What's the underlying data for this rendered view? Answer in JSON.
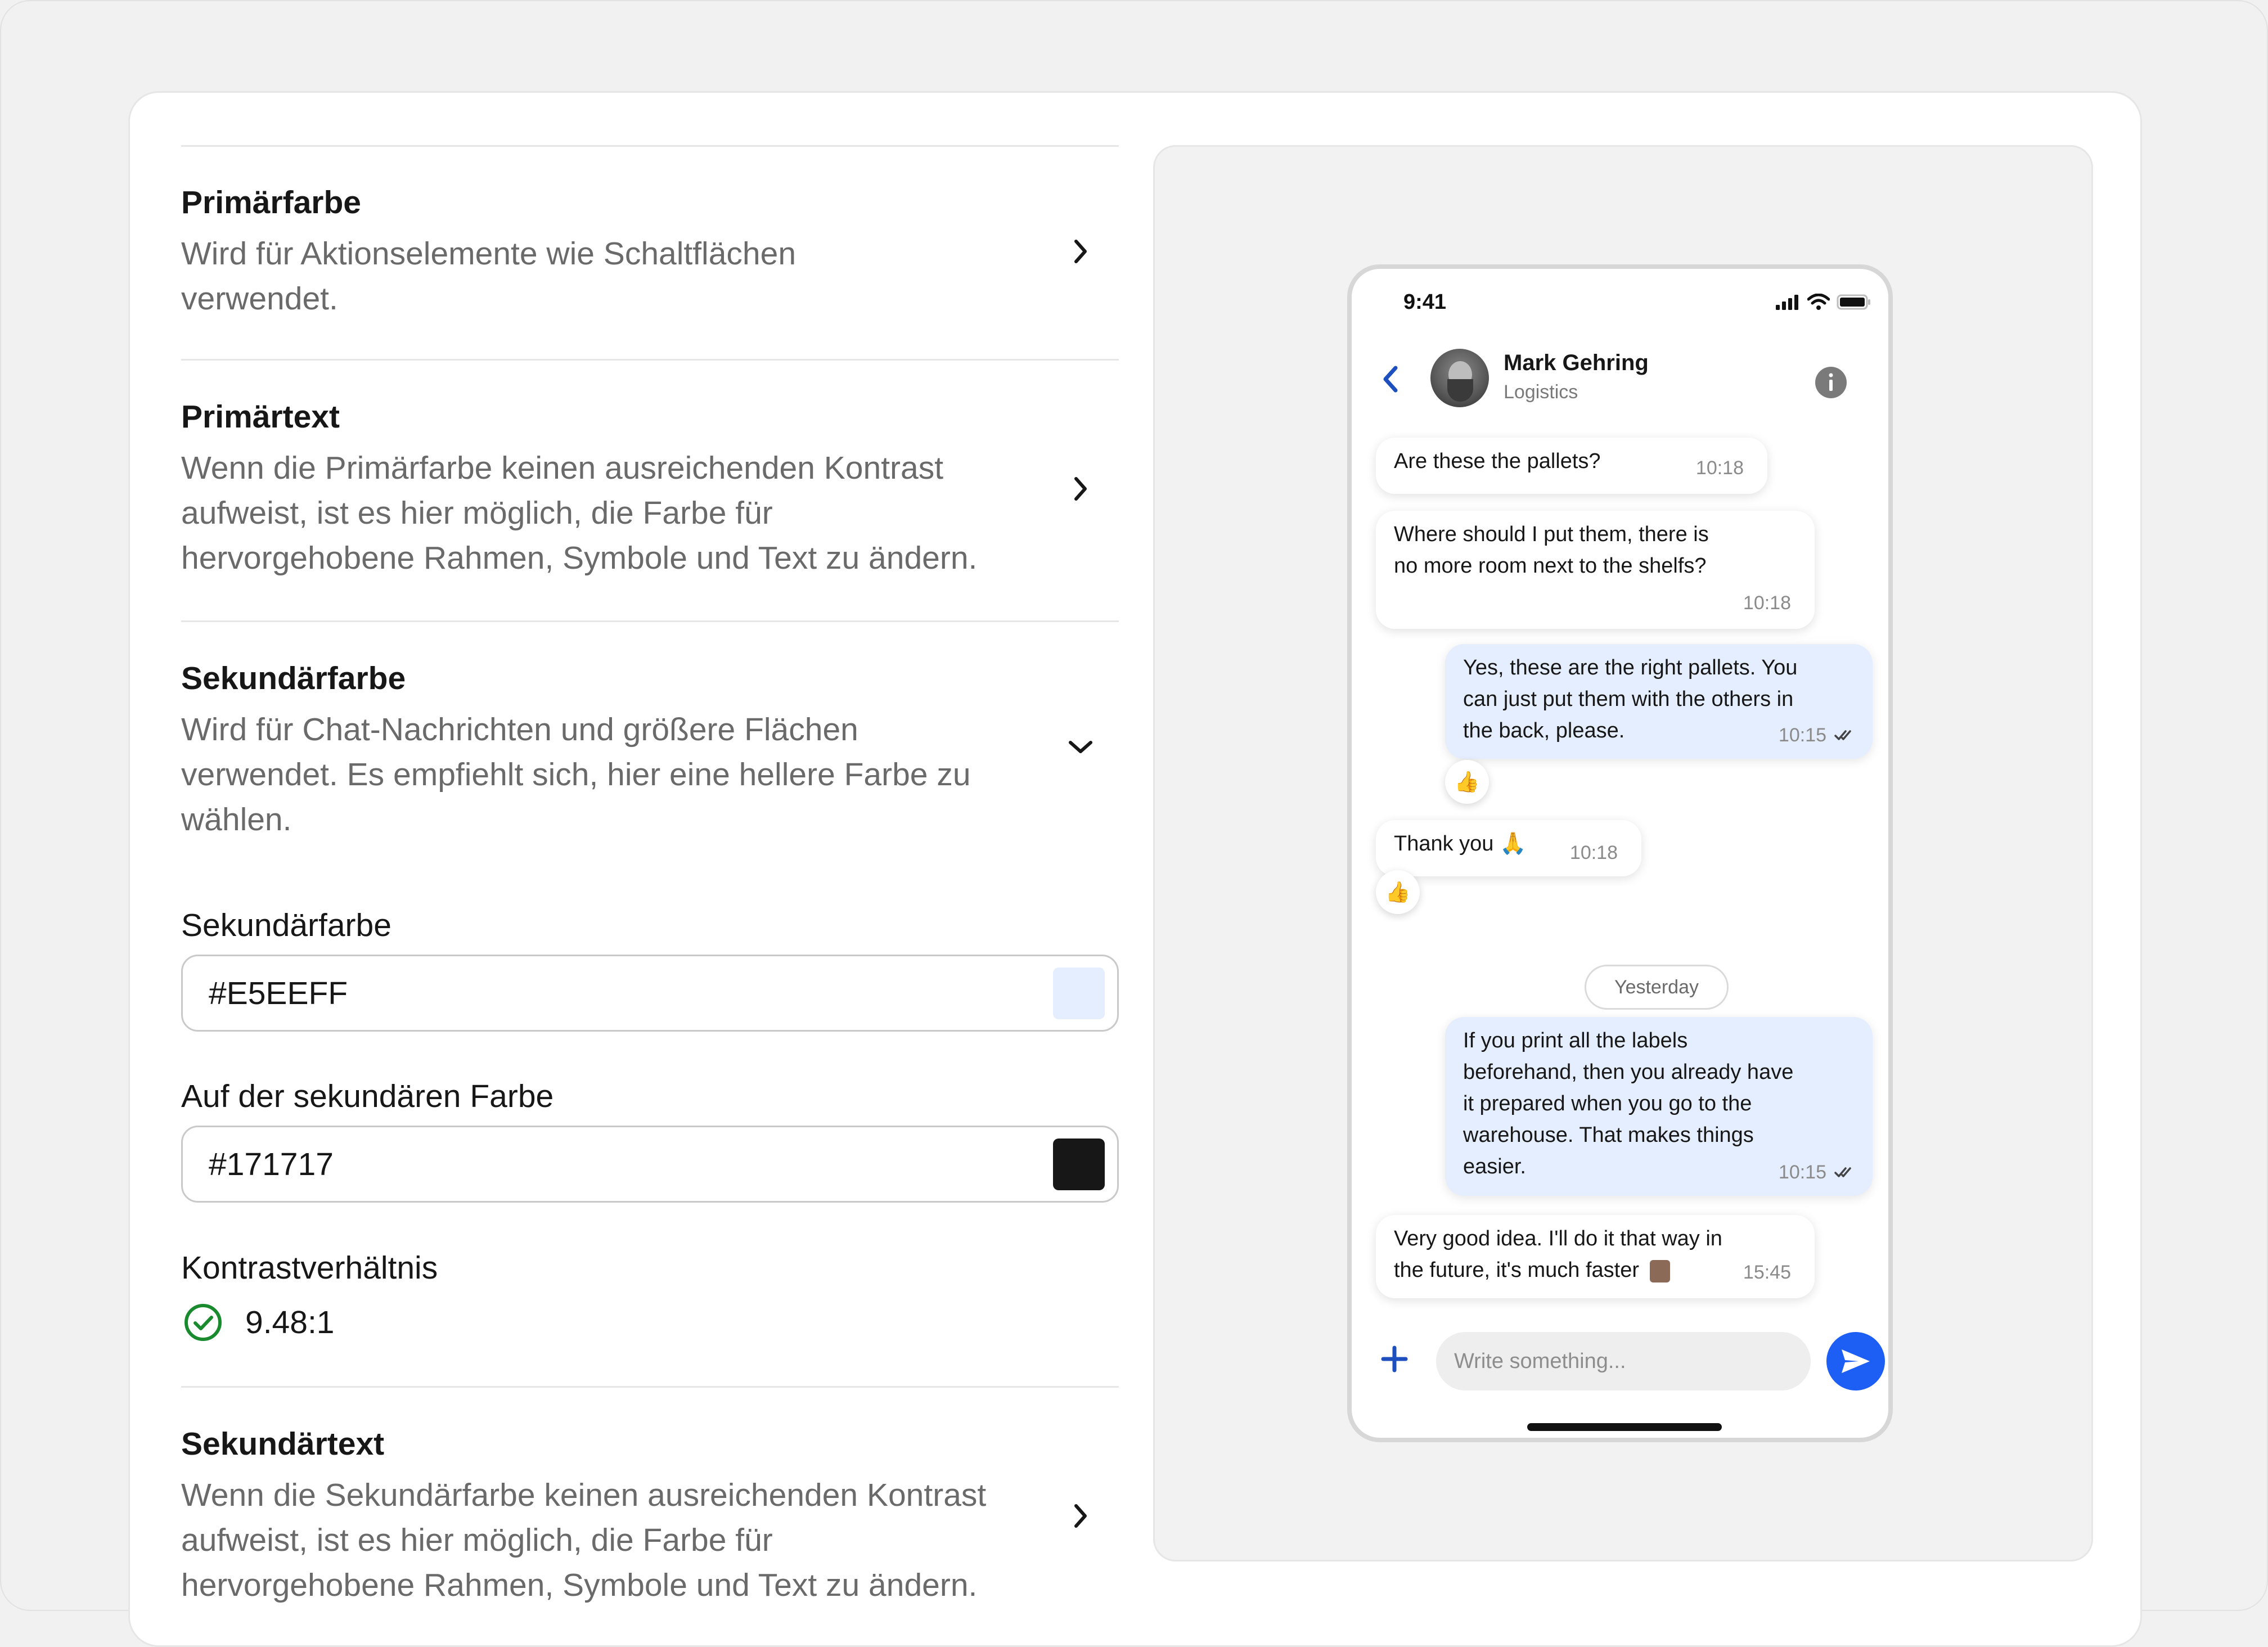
{
  "settings": {
    "primary_color": {
      "title": "Primärfarbe",
      "description": [
        "Wird für Aktionselemente wie Schaltflächen",
        "verwendet."
      ]
    },
    "primary_text": {
      "title": "Primärtext",
      "description": [
        "Wenn die Primärfarbe keinen ausreichenden Kontrast",
        "aufweist, ist es hier möglich, die Farbe für",
        "hervorgehobene Rahmen, Symbole und Text zu ändern."
      ]
    },
    "secondary_color": {
      "title": "Sekundärfarbe",
      "description": [
        "Wird für Chat-Nachrichten und größere Flächen",
        "verwendet. Es empfiehlt sich, hier eine hellere Farbe zu",
        "wählen."
      ],
      "field_label": "Sekundärfarbe",
      "field_value": "#E5EEFF",
      "on_field_label": "Auf der sekundären Farbe",
      "on_field_value": "#171717",
      "contrast_label": "Kontrastverhältnis",
      "contrast_value": "9.48:1"
    },
    "secondary_text": {
      "title": "Sekundärtext",
      "description": [
        "Wenn die Sekundärfarbe keinen ausreichenden Kontrast",
        "aufweist, ist es hier möglich, die Farbe für",
        "hervorgehobene Rahmen, Symbole und Text zu ändern."
      ]
    }
  },
  "colors": {
    "secondary_swatch": "#E5EEFF",
    "on_secondary_swatch": "#171717",
    "accent": "#1d5ef5",
    "contrast_ok": "#1a8a2e"
  },
  "phone": {
    "status_time": "9:41",
    "contact": {
      "name": "Mark Gehring",
      "role": "Logistics"
    },
    "messages": [
      {
        "dir": "in",
        "lines": [
          "Are these the pallets?"
        ],
        "time": "10:18"
      },
      {
        "dir": "in",
        "lines": [
          "Where should I put them, there is",
          "no more room next to the shelfs?"
        ],
        "time": "10:18"
      },
      {
        "dir": "out",
        "lines": [
          "Yes, these are the right pallets. You",
          "can just put them with the others in",
          "the back, please."
        ],
        "time": "10:15"
      },
      {
        "dir": "in",
        "lines": [
          "Thank you 🙏"
        ],
        "time": "10:18"
      },
      {
        "dir": "out",
        "lines": [
          "If you print all the labels",
          "beforehand, then you already have",
          "it prepared when you go to the",
          "warehouse. That makes things",
          "easier."
        ],
        "time": "10:15"
      },
      {
        "dir": "in",
        "lines": [
          "Very good idea. I'll do it that way in",
          "the future, it's much faster"
        ],
        "time": "15:45"
      }
    ],
    "reactions": [
      "👍",
      "👍"
    ],
    "day_separator": "Yesterday",
    "compose_placeholder": "Write something..."
  }
}
